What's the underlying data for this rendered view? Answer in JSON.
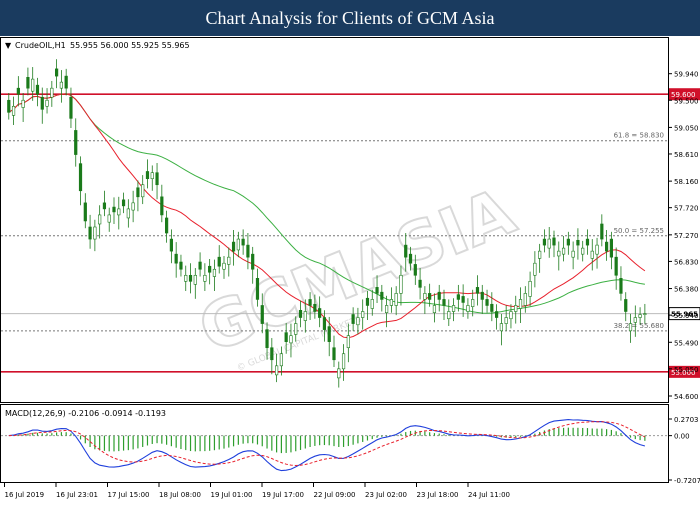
{
  "header": {
    "title": "Chart Analysis for Clients of GCM Asia"
  },
  "colors": {
    "banner": "#1a3b5f",
    "candle": "#1a7a1a",
    "ma_fast": "#e8202c",
    "ma_slow": "#3cb043",
    "level_line": "#d0102a",
    "macd_line": "#1f3fdc",
    "macd_signal": "#e8202c",
    "macd_hist": "#2e9e2e"
  },
  "watermark": {
    "text": "GCMASIA",
    "sub": "© GLOBAL CAPITAL MARKETS"
  },
  "chart_data": [
    {
      "type": "candlestick",
      "symbol_label": "CrudeOIL,H1",
      "ohlc_label": "55.955 56.000 55.925 55.965",
      "ylim": [
        54.6,
        60.2
      ],
      "y_ticks": [
        "59.940",
        "59.500",
        "59.050",
        "58.610",
        "58.160",
        "57.720",
        "57.270",
        "56.830",
        "56.380",
        "55.940",
        "55.490",
        "55.050",
        "54.600"
      ],
      "y_tick_values": [
        59.94,
        59.5,
        59.05,
        58.61,
        58.16,
        57.72,
        57.27,
        56.83,
        56.38,
        55.94,
        55.49,
        55.05,
        54.6
      ],
      "x_ticks": [
        "16 Jul 2019",
        "16 Jul 23:01",
        "17 Jul 15:00",
        "18 Jul 08:00",
        "19 Jul 01:00",
        "19 Jul 17:00",
        "22 Jul 09:00",
        "23 Jul 02:00",
        "23 Jul 18:00",
        "24 Jul 11:00"
      ],
      "horizontal_levels": [
        {
          "value": 59.6,
          "label": "59.600",
          "style": "solid"
        },
        {
          "value": 55.0,
          "label": "55.000",
          "style": "solid"
        }
      ],
      "fib_levels": [
        {
          "value": 58.83,
          "label": "61.8 = 58.830"
        },
        {
          "value": 57.255,
          "label": "50.0 = 57.255"
        },
        {
          "value": 55.68,
          "label": "38.2 = 55.680"
        }
      ],
      "last_price": {
        "value": 55.965,
        "label": "55.965"
      },
      "close": [
        59.3,
        59.4,
        59.6,
        59.5,
        59.7,
        59.85,
        59.6,
        59.35,
        59.5,
        59.7,
        59.9,
        59.8,
        59.7,
        59.2,
        58.6,
        58.0,
        57.5,
        57.2,
        57.4,
        57.6,
        57.7,
        57.6,
        57.65,
        57.7,
        57.75,
        57.7,
        57.8,
        57.9,
        58.1,
        58.2,
        58.3,
        58.1,
        57.6,
        57.3,
        57.0,
        56.8,
        56.7,
        56.6,
        56.5,
        56.6,
        56.7,
        56.6,
        56.65,
        56.7,
        56.75,
        56.8,
        56.9,
        57.0,
        57.2,
        57.1,
        56.9,
        56.7,
        56.2,
        55.8,
        55.4,
        55.2,
        55.1,
        55.3,
        55.5,
        55.6,
        55.8,
        55.9,
        56.0,
        56.1,
        56.0,
        55.9,
        55.7,
        55.5,
        55.2,
        55.05,
        55.3,
        55.6,
        55.8,
        55.9,
        56.0,
        56.1,
        56.2,
        56.3,
        56.2,
        56.1,
        56.2,
        56.3,
        56.6,
        56.9,
        56.8,
        56.6,
        56.4,
        56.3,
        56.2,
        56.1,
        56.2,
        56.1,
        56.0,
        56.1,
        56.2,
        56.15,
        56.1,
        56.2,
        56.3,
        56.2,
        56.1,
        56.0,
        55.9,
        55.8,
        55.9,
        56.0,
        56.1,
        56.2,
        56.3,
        56.5,
        56.8,
        57.0,
        57.1,
        57.2,
        57.1,
        57.0,
        57.05,
        57.1,
        57.0,
        57.1,
        57.05,
        57.1,
        57.0,
        57.1,
        57.2,
        57.0,
        56.9,
        56.6,
        56.3,
        56.0,
        55.8,
        55.9,
        55.95,
        55.965
      ],
      "open_offset": [
        0.2,
        -0.15,
        0.1,
        -0.12,
        0.18,
        -0.2,
        0.15,
        0.2,
        -0.1,
        -0.15,
        0.12,
        -0.1,
        0.2,
        0.35,
        0.4,
        0.45,
        0.3,
        0.2,
        -0.2,
        -0.15,
        0.1,
        -0.12,
        0.08,
        -0.1,
        0.1,
        -0.15,
        -0.12,
        0.15,
        -0.2,
        0.12,
        -0.1,
        0.2,
        0.3,
        0.25,
        0.2,
        0.15,
        0.12,
        -0.1,
        0.1,
        -0.15,
        0.12,
        -0.1,
        0.1,
        -0.12,
        0.15,
        -0.1,
        -0.12,
        0.15,
        -0.18,
        0.1,
        0.2,
        0.25,
        0.35,
        0.3,
        0.3,
        0.2,
        -0.15,
        -0.2,
        0.15,
        -0.12,
        -0.18,
        0.12,
        -0.15,
        0.1,
        0.12,
        0.15,
        0.2,
        0.25,
        0.2,
        -0.15,
        -0.25,
        -0.2,
        0.15,
        -0.12,
        -0.1,
        0.12,
        -0.15,
        0.1,
        0.12,
        -0.12,
        -0.1,
        -0.2,
        -0.3,
        0.2,
        0.15,
        0.18,
        0.12,
        -0.1,
        0.1,
        -0.12,
        0.12,
        0.1,
        -0.12,
        -0.1,
        0.08,
        0.1,
        -0.1,
        -0.12,
        0.1,
        0.12,
        0.1,
        0.12,
        0.1,
        -0.12,
        -0.1,
        -0.12,
        -0.1,
        -0.15,
        -0.2,
        -0.25,
        -0.2,
        -0.12,
        0.1,
        -0.15,
        0.12,
        -0.08,
        -0.1,
        0.1,
        -0.1,
        0.08,
        -0.1,
        0.1,
        -0.12,
        -0.15,
        0.25,
        0.15,
        0.3,
        0.3,
        0.25,
        0.2,
        -0.12,
        -0.08,
        -0.05,
        -0.01
      ]
    },
    {
      "type": "line",
      "label": "MACD(12,26,9) -0.2106 -0.0914 -0.1193",
      "ylim": [
        -0.7207,
        0.2703
      ],
      "y_ticks": [
        "0.2703",
        "0.00",
        "-0.7207"
      ],
      "y_tick_values": [
        0.2703,
        0.0,
        -0.7207
      ]
    }
  ]
}
